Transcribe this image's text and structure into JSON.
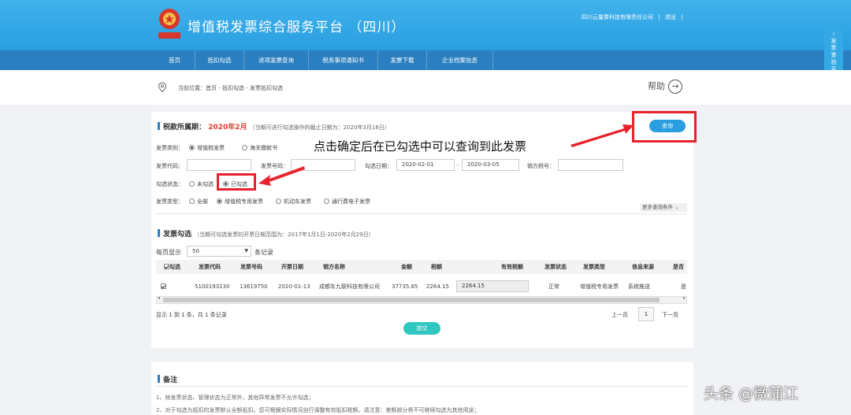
{
  "header": {
    "title": "增值税发票综合服务平台 （四川）",
    "company": "四川云量算科技有限责任公司",
    "logout": "退出",
    "sep": "|"
  },
  "nav": {
    "items": [
      "首页",
      "抵扣勾选",
      "进项发票查询",
      "税务事项通知书",
      "发票下载",
      "企业档案信息"
    ]
  },
  "side_tab": {
    "label": "发票查验平台"
  },
  "breadcrumb": {
    "text": "当前位置：首页 - 抵扣勾选 - 发票抵扣勾选",
    "help": "帮助"
  },
  "period": {
    "title": "税款所属期：",
    "value": "2020年2月",
    "note": "（当期可进行勾选操作的截止日期为：2020年3月16日）"
  },
  "query_button": "查询",
  "annotation": "点击确定后在已勾选中可以查询到此发票",
  "filters": {
    "invoice_category_label": "发票类别：",
    "invoice_category_options": [
      "增值税发票",
      "海关缴款书"
    ],
    "invoice_code_label": "发票代码：",
    "invoice_no_label": "发票号码：",
    "select_date_label": "勾选日期：",
    "date_from": "2020-02-01",
    "date_to": "2020-03-05",
    "date_sep": "-",
    "seller_tax_label": "销方税号：",
    "status_label": "勾选状态：",
    "status_options": [
      "未勾选",
      "已勾选"
    ],
    "type_label": "发票类型：",
    "type_options": [
      "全部",
      "增值税专用发票",
      "机动车发票",
      "通行费电子发票"
    ],
    "more": "更多查询条件"
  },
  "invoice_section": {
    "title": "发票勾选",
    "note": "（当期可勾选发票的开票日期范围为：2017年1月1日-2020年2月29日）",
    "per_page_label": "每页显示",
    "per_page_value": "50",
    "per_page_suffix": "条记录"
  },
  "table": {
    "headers": [
      "勾选",
      "发票代码",
      "发票号码",
      "开票日期",
      "销方名称",
      "金额",
      "税额",
      "有效税额",
      "发票状态",
      "发票类型",
      "信息来源",
      "是否"
    ],
    "row": {
      "code": "5100193130",
      "number": "13619750",
      "date": "2020-01-13",
      "seller": "成都车九联科技有限公司",
      "amount": "37735.85",
      "tax": "2264.15",
      "effective_tax": "2264.15",
      "status": "正常",
      "type": "增值税专用发票",
      "source": "系统推送",
      "extra": "是"
    }
  },
  "pagination": {
    "summary": "显示 1 到 1 条，共 1 条记录",
    "prev": "上一页",
    "page": "1",
    "next": "下一页"
  },
  "submit_button": "提交",
  "remarks": {
    "title": "备注",
    "lines": [
      "1、除发票状态、管理状态为正常外，其他异常发票不允许勾选；",
      "2、对于勾选为抵扣的发票默认全额抵扣。您可根据实际情况自行调整有效抵扣税额。请注意：差额部分将不可继续勾选为其他用途；"
    ]
  },
  "watermark": "头条 @微蒲江",
  "colors": {
    "header": "#3fb2ec",
    "nav": "#2a7fc0",
    "accent_red": "#e8222a",
    "submit": "#2fc7c0"
  }
}
